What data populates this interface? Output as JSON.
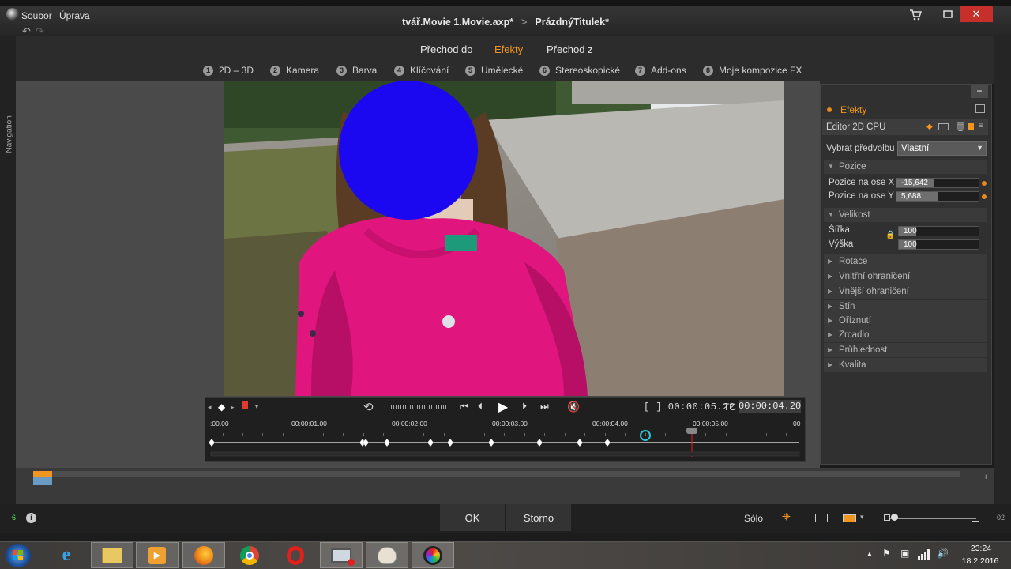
{
  "app": {
    "menu": [
      "Soubor",
      "Úprava"
    ],
    "title_project": "tvář.Movie 1.Movie.axp*",
    "title_sep": ">",
    "title_item": "PrázdnýTitulek*"
  },
  "top_tabs": [
    "Přechod do",
    "Efekty",
    "Přechod z"
  ],
  "active_tab": "Efekty",
  "categories": [
    {
      "num": "1",
      "label": "2D – 3D"
    },
    {
      "num": "2",
      "label": "Kamera"
    },
    {
      "num": "3",
      "label": "Barva"
    },
    {
      "num": "4",
      "label": "Klíčování"
    },
    {
      "num": "5",
      "label": "Umělecké"
    },
    {
      "num": "6",
      "label": "Stereoskopické"
    },
    {
      "num": "7",
      "label": "Add-ons"
    },
    {
      "num": "8",
      "label": "Moje kompozice FX"
    }
  ],
  "left_nav_label": "Navigation",
  "panel": {
    "header": "Efekty",
    "editor": "Editor 2D CPU",
    "preset_label": "Vybrat předvolbu",
    "preset_value": "Vlastní",
    "pozice": {
      "title": "Pozice",
      "x_label": "Pozice na ose X",
      "x_value": "-15,642",
      "y_label": "Pozice na ose Y",
      "y_value": "5,688"
    },
    "velikost": {
      "title": "Velikost",
      "width_label": "Šířka",
      "width_value": "100",
      "height_label": "Výška",
      "height_value": "100"
    },
    "sections": [
      "Rotace",
      "Vnitřní ohraničení",
      "Vnější ohraničení",
      "Stín",
      "Oříznutí",
      "Zrcadlo",
      "Průhlednost",
      "Kvalita"
    ]
  },
  "transport": {
    "duration": "[ ] 00:00:05.22",
    "tc_label": "TC",
    "tc_value": "00:00:04.20",
    "tick_labels": [
      ":00.00",
      "00:00:01.00",
      "00:00:02.00",
      "00:00:03.00",
      "00:00:04.00",
      "00:00:05.00",
      "00"
    ]
  },
  "bottom": {
    "ok": "OK",
    "cancel": "Storno",
    "solo": "Sólo",
    "left_value": "-6",
    "right_value": "02"
  },
  "taskbar": {
    "time": "23:24",
    "date": "18.2.2016"
  },
  "colors": {
    "accent": "#f0961e",
    "face_blur": "#1b08f0",
    "jacket": "#e0157e",
    "close": "#c7302a"
  }
}
